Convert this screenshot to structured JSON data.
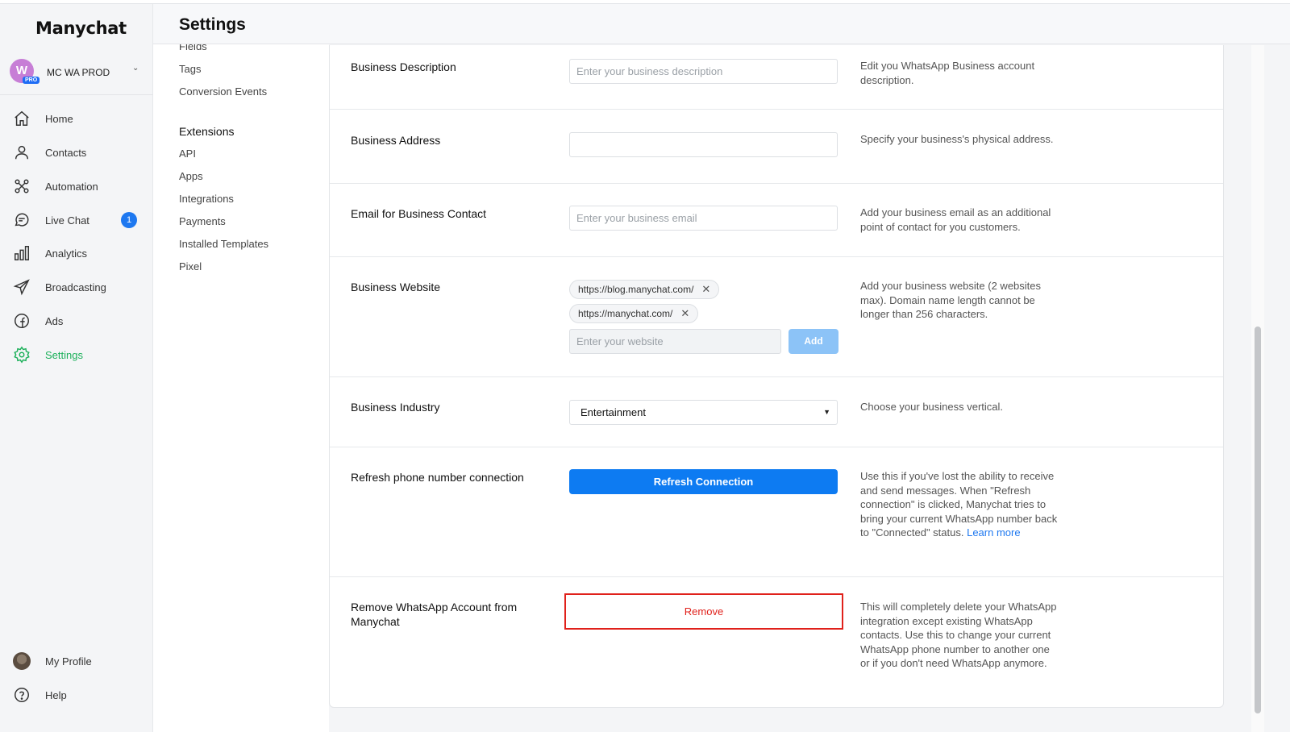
{
  "app": {
    "logo": "Manychat",
    "account": {
      "avatar_letter": "W",
      "plan_badge": "PRO",
      "name": "MC WA PROD"
    }
  },
  "nav": {
    "items": [
      {
        "label": "Home",
        "icon": "home-icon"
      },
      {
        "label": "Contacts",
        "icon": "user-icon"
      },
      {
        "label": "Automation",
        "icon": "automation-icon"
      },
      {
        "label": "Live Chat",
        "icon": "chat-icon",
        "badge": "1"
      },
      {
        "label": "Analytics",
        "icon": "bar-chart-icon"
      },
      {
        "label": "Broadcasting",
        "icon": "send-icon"
      },
      {
        "label": "Ads",
        "icon": "ads-icon"
      },
      {
        "label": "Settings",
        "icon": "gear-icon",
        "active": true
      }
    ],
    "bottom": [
      {
        "label": "My Profile",
        "icon": "avatar"
      },
      {
        "label": "Help",
        "icon": "help-icon"
      }
    ]
  },
  "header": {
    "title": "Settings"
  },
  "subnav": {
    "items_top": [
      "Fields",
      "Tags",
      "Conversion Events"
    ],
    "extensions_heading": "Extensions",
    "items_ext": [
      "API",
      "Apps",
      "Integrations",
      "Payments",
      "Installed Templates",
      "Pixel"
    ]
  },
  "settings": {
    "description": {
      "label": "Business Description",
      "placeholder": "Enter your business description",
      "help": "Edit you WhatsApp Business account description."
    },
    "address": {
      "label": "Business Address",
      "placeholder": "",
      "help": "Specify your business's physical address."
    },
    "email": {
      "label": "Email for Business Contact",
      "placeholder": "Enter your business email",
      "help": "Add your business email as an additional point of contact for you customers."
    },
    "website": {
      "label": "Business Website",
      "chips": [
        "https://blog.manychat.com/",
        "https://manychat.com/"
      ],
      "placeholder": "Enter your website",
      "add_label": "Add",
      "help": "Add your business website (2 websites max). Domain name length cannot be longer than 256 characters."
    },
    "industry": {
      "label": "Business Industry",
      "value": "Entertainment",
      "help": "Choose your business vertical."
    },
    "refresh": {
      "label": "Refresh phone number connection",
      "button": "Refresh Connection",
      "help": "Use this if you've lost the ability to receive and send messages. When \"Refresh connection\" is clicked, Manychat tries to bring your current WhatsApp number back to \"Connected\" status.",
      "link": "Learn more"
    },
    "remove": {
      "label": "Remove WhatsApp Account from Manychat",
      "button": "Remove",
      "help": "This will completely delete your WhatsApp integration except existing WhatsApp contacts. Use this to change your current WhatsApp phone number to another one or if you don't need WhatsApp anymore."
    }
  },
  "colors": {
    "accent_green": "#1cb05a",
    "primary_blue": "#0d7bf2",
    "danger_red": "#e0211b",
    "badge_blue": "#1e78f0"
  }
}
